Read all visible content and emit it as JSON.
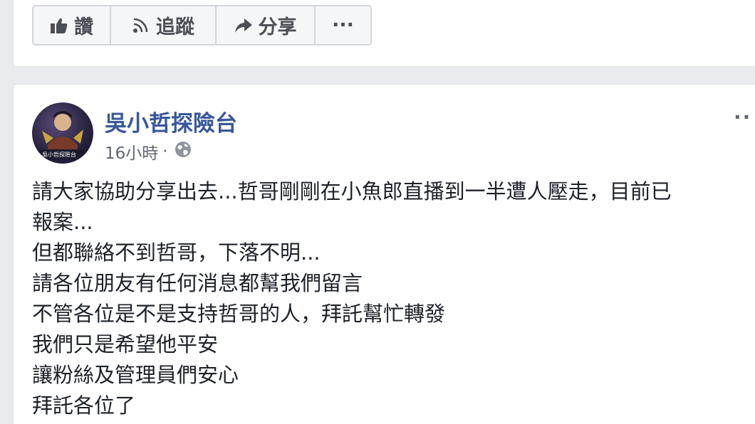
{
  "actions": {
    "like_label": "讚",
    "follow_label": "追蹤",
    "share_label": "分享",
    "more_label": "···"
  },
  "post": {
    "page_name": "吳小哲探險台",
    "avatar_caption": "吳小哲探險台",
    "timestamp": "16小時",
    "separator": "·",
    "more_label": "··",
    "lines": [
      "請大家協助分享出去...哲哥剛剛在小魚郎直播到一半遭人壓走，目前已",
      "報案...",
      "但都聯絡不到哲哥，下落不明...",
      "請各位朋友有任何消息都幫我們留言",
      "不管各位是不是支持哲哥的人，拜託幫忙轉發",
      "我們只是希望他平安",
      "讓粉絲及管理員們安心",
      "拜託各位了"
    ]
  },
  "icons": {
    "like": "thumbs-up-icon",
    "follow": "rss-icon",
    "share": "share-arrow-icon",
    "privacy": "globe-icon"
  },
  "colors": {
    "page_name": "#385898",
    "background": "#e9ebee",
    "text": "#1d2129",
    "meta": "#616770"
  }
}
